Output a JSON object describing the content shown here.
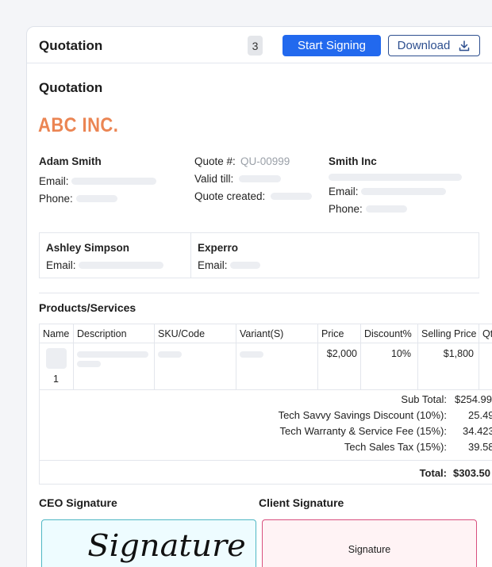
{
  "toolbar": {
    "title": "Quotation",
    "count": "3",
    "start_signing_label": "Start Signing",
    "download_label": "Download",
    "download_icon": "download-icon"
  },
  "document": {
    "title": "Quotation",
    "company_logo": "ABC INC.",
    "sender": {
      "name": "Adam Smith",
      "email_label": "Email:",
      "phone_label": "Phone:"
    },
    "quote": {
      "number_label": "Quote #:",
      "number_value": "QU-00999",
      "valid_till_label": "Valid till:",
      "created_label": "Quote created:"
    },
    "client": {
      "name": "Smith Inc",
      "email_label": "Email:",
      "phone_label": "Phone:"
    },
    "recipients": [
      {
        "name": "Ashley Simpson",
        "email_label": "Email:"
      },
      {
        "name": "Experro",
        "email_label": "Email:"
      }
    ],
    "products_title": "Products/Services",
    "table": {
      "headers": [
        "Name",
        "Description",
        "SKU/Code",
        "Variant(S)",
        "Price",
        "Discount%",
        "Selling Price",
        "Qty"
      ],
      "rows": [
        {
          "qty_index": "1",
          "price": "$2,000",
          "discount": "10%",
          "selling_price": "$1,800"
        }
      ]
    },
    "totals": [
      {
        "label": "Sub Total:",
        "value": "$254.99"
      },
      {
        "label": "Tech Savvy Savings Discount (10%):",
        "value": "25.49"
      },
      {
        "label": "Tech Warranty & Service Fee (15%):",
        "value": "34.423"
      },
      {
        "label": "Tech Sales Tax (15%):",
        "value": "39.58"
      }
    ],
    "grand_total": {
      "label": "Total:",
      "value": "$303.50"
    },
    "signatures": {
      "ceo_title": "CEO Signature",
      "ceo_signature": "Signature",
      "client_title": "Client Signature",
      "client_signature": "Signature"
    }
  },
  "colors": {
    "primary": "#2269ee",
    "logo": "#eb8553",
    "ceo_box_border": "#4fb7c4",
    "client_box_border": "#d84f7e"
  }
}
